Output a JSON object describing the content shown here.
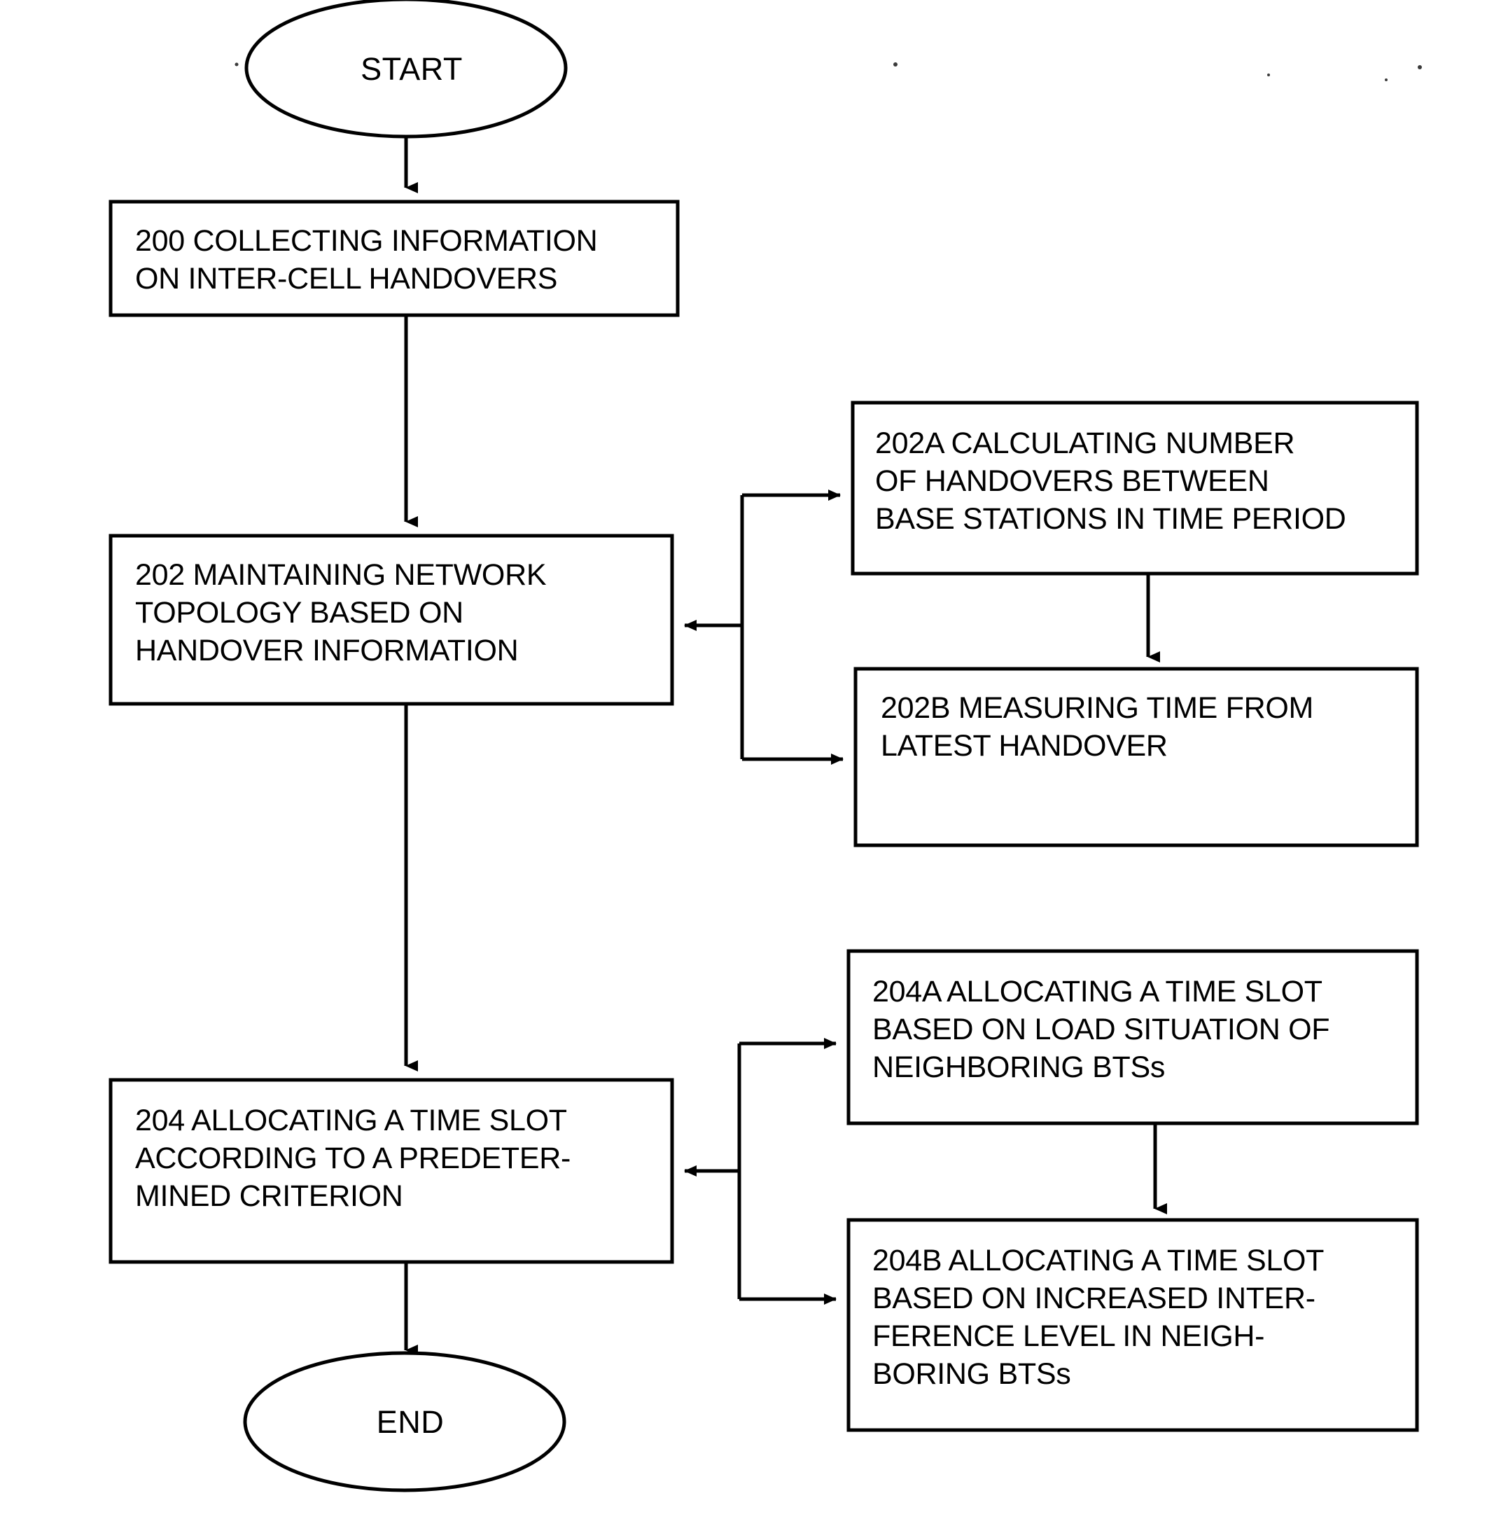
{
  "figure": {
    "type": "flowchart",
    "orientation": "vertical",
    "background_color": "#ffffff",
    "line_color": "#000000"
  },
  "nodes": {
    "start": {
      "label": "START",
      "shape": "ellipse"
    },
    "step200": {
      "shape": "rectangle",
      "lines": [
        "200 COLLECTING INFORMATION",
        "ON INTER-CELL HANDOVERS"
      ]
    },
    "step202": {
      "shape": "rectangle",
      "lines": [
        "202 MAINTAINING NETWORK",
        "TOPOLOGY BASED ON",
        "HANDOVER INFORMATION"
      ]
    },
    "step202a": {
      "shape": "rectangle",
      "lines": [
        "202A CALCULATING NUMBER",
        "OF HANDOVERS BETWEEN",
        "BASE STATIONS IN TIME PERIOD"
      ]
    },
    "step202b": {
      "shape": "rectangle",
      "lines": [
        "202B MEASURING TIME FROM",
        "LATEST HANDOVER"
      ]
    },
    "step204": {
      "shape": "rectangle",
      "lines": [
        "204 ALLOCATING A TIME SLOT",
        "ACCORDING TO A PREDETER-",
        "MINED CRITERION"
      ]
    },
    "step204a": {
      "shape": "rectangle",
      "lines": [
        "204A ALLOCATING A TIME SLOT",
        "BASED ON LOAD SITUATION OF",
        "NEIGHBORING BTSs"
      ]
    },
    "step204b": {
      "shape": "rectangle",
      "lines": [
        "204B ALLOCATING A TIME SLOT",
        "BASED ON INCREASED INTER-",
        "FERENCE LEVEL IN NEIGH-",
        "BORING BTSs"
      ]
    },
    "end": {
      "label": "END",
      "shape": "ellipse"
    }
  },
  "edges": [
    {
      "from": "start",
      "to": "step200",
      "style": "arrow-down"
    },
    {
      "from": "step200",
      "to": "step202",
      "style": "arrow-down"
    },
    {
      "from": "step202a",
      "to": "step202b",
      "style": "arrow-down"
    },
    {
      "from": "branch202",
      "to": "step202",
      "style": "arrow-left"
    },
    {
      "from": "branch202",
      "to": "step202a",
      "style": "arrow-right"
    },
    {
      "from": "branch202",
      "to": "step202b",
      "style": "arrow-right"
    },
    {
      "from": "step202",
      "to": "step204",
      "style": "arrow-down"
    },
    {
      "from": "step204a",
      "to": "step204b",
      "style": "arrow-down"
    },
    {
      "from": "branch204",
      "to": "step204",
      "style": "arrow-left"
    },
    {
      "from": "branch204",
      "to": "step204a",
      "style": "arrow-right"
    },
    {
      "from": "branch204",
      "to": "step204b",
      "style": "arrow-right"
    },
    {
      "from": "step204",
      "to": "end",
      "style": "arrow-down"
    }
  ]
}
